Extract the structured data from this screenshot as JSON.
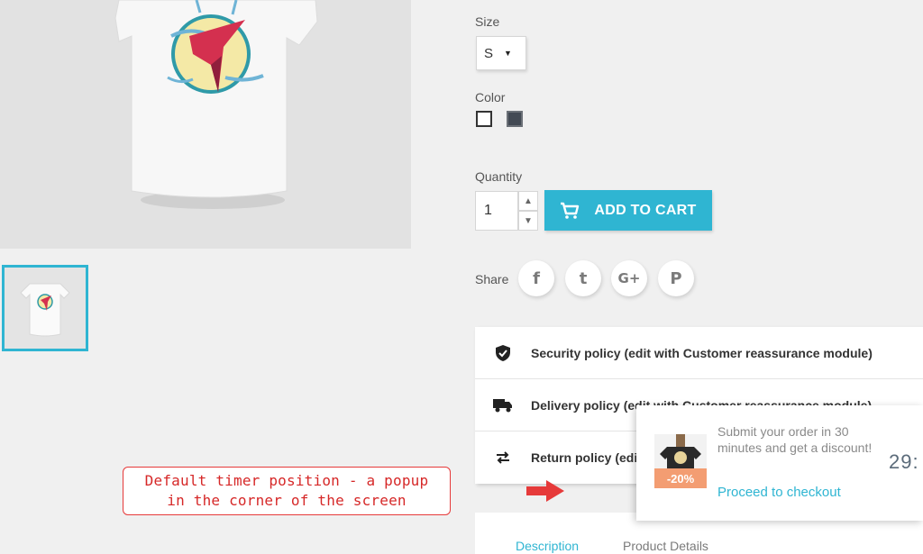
{
  "options": {
    "size_label": "Size",
    "size_value": "S",
    "color_label": "Color",
    "colors": [
      "#ffffff",
      "#434a54"
    ],
    "quantity_label": "Quantity",
    "quantity_value": "1",
    "add_to_cart_label": "ADD TO CART"
  },
  "share": {
    "label": "Share",
    "networks": [
      {
        "name": "facebook",
        "glyph": "f"
      },
      {
        "name": "twitter",
        "glyph": "t"
      },
      {
        "name": "google-plus",
        "glyph": "G+"
      },
      {
        "name": "pinterest",
        "glyph": "P"
      }
    ]
  },
  "reassurance": [
    {
      "icon": "shield-icon",
      "text": "Security policy (edit with Customer reassurance module)"
    },
    {
      "icon": "truck-icon",
      "text": "Delivery policy (edit with Customer reassurance module)"
    },
    {
      "icon": "return-arrows-icon",
      "text": "Return policy (edit with Customer reassurance module)"
    }
  ],
  "tabs": [
    "Description",
    "Product Details"
  ],
  "annotation": {
    "line1": "Default timer position - a popup",
    "line2": "in the corner of the screen",
    "arrow_color": "#e63a3a"
  },
  "timer_popup": {
    "message": "Submit your order in 30 minutes and get a discount!",
    "link": "Proceed to checkout",
    "badge": "-20%",
    "timer": "29:"
  },
  "accent_color": "#2fb5d2"
}
